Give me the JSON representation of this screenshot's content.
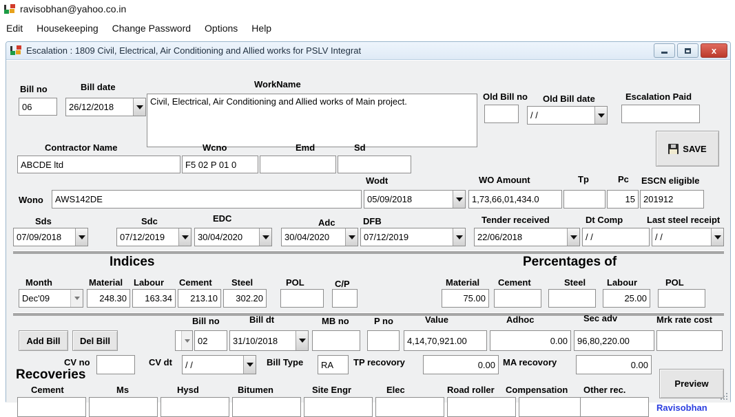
{
  "app": {
    "account": "ravisobhan@yahoo.co.in",
    "menu": [
      "Edit",
      "Housekeeping",
      "Change Password",
      "Options",
      "Help"
    ]
  },
  "window": {
    "title": "Escalation : 1809  Civil, Electrical, Air Conditioning and Allied works for PSLV Integrat",
    "minimize": "–",
    "maximize": "□",
    "close": "x"
  },
  "header": {
    "bill_no_label": "Bill no",
    "bill_no_value": "06",
    "bill_date_label": "Bill date",
    "bill_date_value": "26/12/2018",
    "workname_label": "WorkName",
    "workname_value": "Civil, Electrical, Air Conditioning and Allied works of Main project.",
    "old_bill_no_label": "Old Bill no",
    "old_bill_no_value": "",
    "old_bill_date_label": "Old Bill date",
    "old_bill_date_value": "/ /",
    "escalation_paid_label": "Escalation Paid",
    "escalation_paid_value": "",
    "save_label": "SAVE"
  },
  "contractor": {
    "name_label": "Contractor Name",
    "name_value": "ABCDE ltd",
    "wcno_label": "Wcno",
    "wcno_value": "F5 02 P 01 0",
    "emd_label": "Emd",
    "emd_value": "",
    "sd_label": "Sd",
    "sd_value": ""
  },
  "workorder": {
    "wono_label": "Wono",
    "wono_value": "AWS142DE",
    "wodt_label": "Wodt",
    "wodt_value": "05/09/2018",
    "wo_amount_label": "WO Amount",
    "wo_amount_value": "1,73,66,01,434.0",
    "tp_label": "Tp",
    "tp_value": "",
    "pc_label": "Pc",
    "pc_value": "15",
    "escn_label": "ESCN eligible",
    "escn_value": "201912"
  },
  "dates": {
    "sds_label": "Sds",
    "sds_value": "07/09/2018",
    "sdc_label": "Sdc",
    "sdc_value": "07/12/2019",
    "edc_label": "EDC",
    "edc_value": "30/04/2020",
    "adc_label": "Adc",
    "adc_value": "30/04/2020",
    "dfb_label": "DFB",
    "dfb_value": "07/12/2019",
    "tender_label": "Tender received",
    "tender_value": "22/06/2018",
    "dtcomp_label": "Dt Comp",
    "dtcomp_value": "/ /",
    "laststeel_label": "Last steel receipt",
    "laststeel_value": "/ /"
  },
  "indices": {
    "title": "Indices",
    "month_label": "Month",
    "month_value": "Dec'09",
    "columns": [
      {
        "label": "Material",
        "value": "248.30"
      },
      {
        "label": "Labour",
        "value": "163.34"
      },
      {
        "label": "Cement",
        "value": "213.10"
      },
      {
        "label": "Steel",
        "value": "302.20"
      },
      {
        "label": "POL",
        "value": ""
      },
      {
        "label": "C/P",
        "value": ""
      }
    ]
  },
  "percentages": {
    "title": "Percentages of",
    "columns": [
      {
        "label": "Material",
        "value": "75.00"
      },
      {
        "label": "Cement",
        "value": ""
      },
      {
        "label": "Steel",
        "value": ""
      },
      {
        "label": "Labour",
        "value": "25.00"
      },
      {
        "label": "POL",
        "value": ""
      }
    ]
  },
  "bill": {
    "add_bill_label": "Add Bill",
    "del_bill_label": "Del Bill",
    "bill_no_label": "Bill no",
    "bill_no_value": "02",
    "bill_dt_label": "Bill dt",
    "bill_dt_value": "31/10/2018",
    "mb_no_label": "MB no",
    "mb_no_value": "",
    "p_no_label": "P no",
    "p_no_value": "",
    "value_label": "Value",
    "value_value": "4,14,70,921.00",
    "adhoc_label": "Adhoc",
    "adhoc_value": "0.00",
    "sec_adv_label": "Sec adv",
    "sec_adv_value": "96,80,220.00",
    "mrk_rate_label": "Mrk rate cost",
    "mrk_rate_value": ""
  },
  "cv": {
    "cv_no_label": "CV no",
    "cv_no_value": "",
    "cv_dt_label": "CV dt",
    "cv_dt_value": "/ /",
    "bill_type_label": "Bill Type",
    "bill_type_value": "RA",
    "tp_recovery_label": "TP recovory",
    "tp_recovery_value": "0.00",
    "ma_recovery_label": "MA recovory",
    "ma_recovery_value": "0.00"
  },
  "recoveries": {
    "title": "Recoveries",
    "columns": [
      {
        "label": "Cement",
        "value": ""
      },
      {
        "label": "Ms",
        "value": ""
      },
      {
        "label": "Hysd",
        "value": ""
      },
      {
        "label": "Bitumen",
        "value": ""
      },
      {
        "label": "Site Engr",
        "value": ""
      },
      {
        "label": "Elec",
        "value": ""
      },
      {
        "label": "Road roller",
        "value": ""
      },
      {
        "label": "Compensation",
        "value": ""
      },
      {
        "label": "Other rec.",
        "value": ""
      }
    ]
  },
  "footer": {
    "preview_label": "Preview",
    "user_link": "Ravisobhan"
  }
}
